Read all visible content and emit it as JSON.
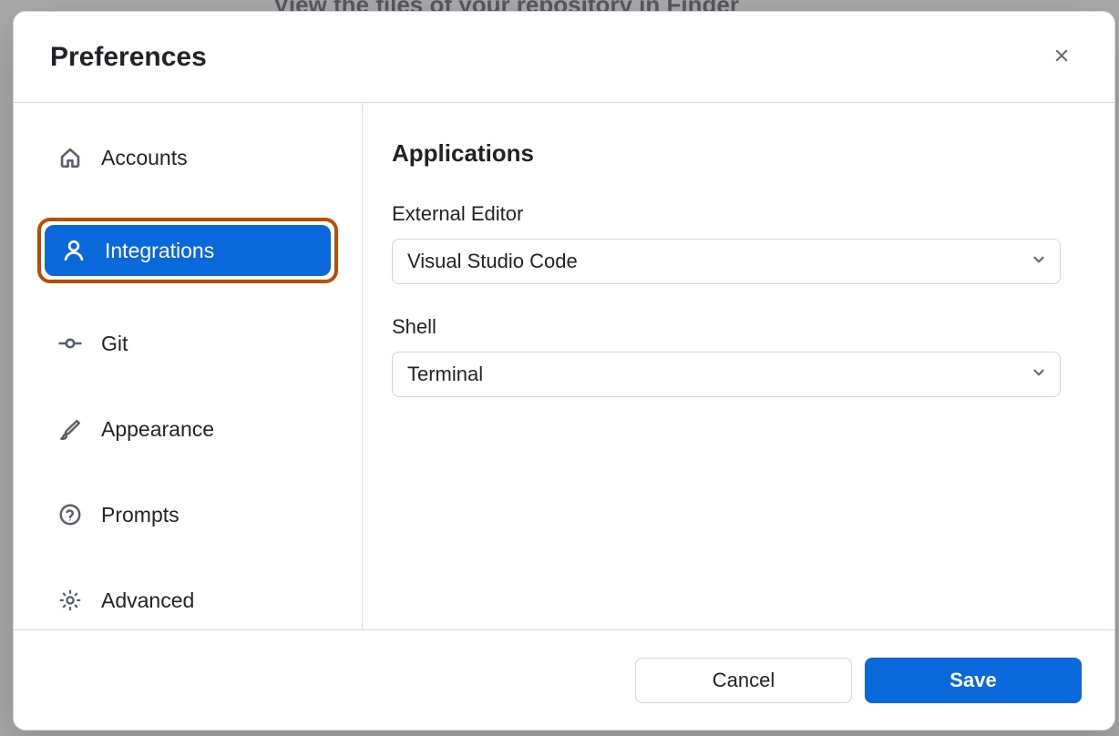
{
  "background_hint": "View the files of your repository in Finder",
  "modal": {
    "title": "Preferences",
    "sidebar": {
      "items": [
        {
          "id": "accounts",
          "label": "Accounts",
          "icon": "home-icon"
        },
        {
          "id": "integrations",
          "label": "Integrations",
          "icon": "person-icon",
          "active": true,
          "highlighted": true
        },
        {
          "id": "git",
          "label": "Git",
          "icon": "commit-icon"
        },
        {
          "id": "appearance",
          "label": "Appearance",
          "icon": "brush-icon"
        },
        {
          "id": "prompts",
          "label": "Prompts",
          "icon": "question-icon"
        },
        {
          "id": "advanced",
          "label": "Advanced",
          "icon": "gear-icon"
        }
      ]
    },
    "content": {
      "section_title": "Applications",
      "fields": {
        "external_editor": {
          "label": "External Editor",
          "value": "Visual Studio Code"
        },
        "shell": {
          "label": "Shell",
          "value": "Terminal"
        }
      }
    },
    "footer": {
      "cancel_label": "Cancel",
      "save_label": "Save"
    }
  }
}
